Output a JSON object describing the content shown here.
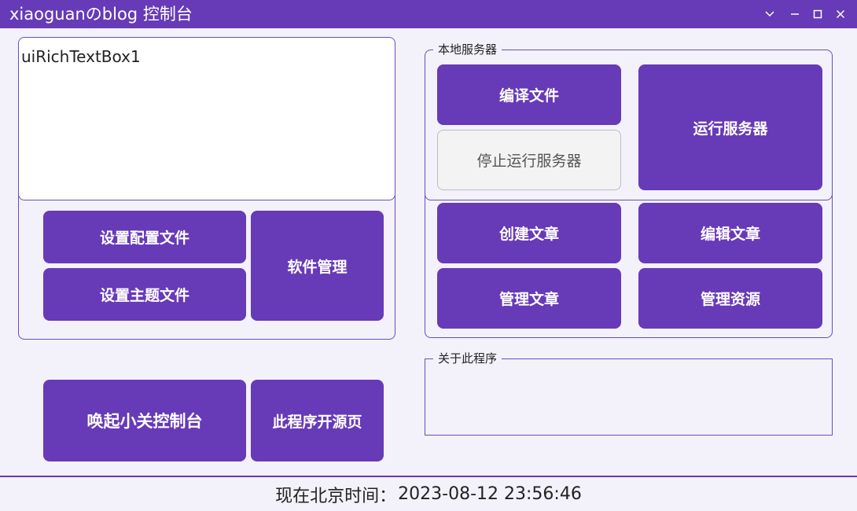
{
  "window": {
    "title": "xiaoguanのblog 控制台",
    "controls": [
      "chevron-down-icon",
      "minimize-icon",
      "maximize-icon",
      "close-icon"
    ],
    "accent": "#673ab7"
  },
  "richtext": {
    "value": "uiRichTextBox1"
  },
  "left_panel": {
    "set_config_label": "设置配置文件",
    "set_theme_label": "设置主题文件",
    "software_mgmt_label": "软件管理",
    "launch_console_label": "唤起小关控制台",
    "open_source_label": "此程序开源页"
  },
  "server_group": {
    "legend": "本地服务器",
    "compile_label": "编译文件",
    "stop_server_label": "停止运行服务器",
    "run_server_label": "运行服务器"
  },
  "article_panel": {
    "create_label": "创建文章",
    "edit_label": "编辑文章",
    "manage_label": "管理文章",
    "resources_label": "管理资源"
  },
  "about_group": {
    "legend": "关于此程序"
  },
  "status": {
    "label": "现在北京时间：",
    "time": "2023-08-12 23:56:46"
  }
}
